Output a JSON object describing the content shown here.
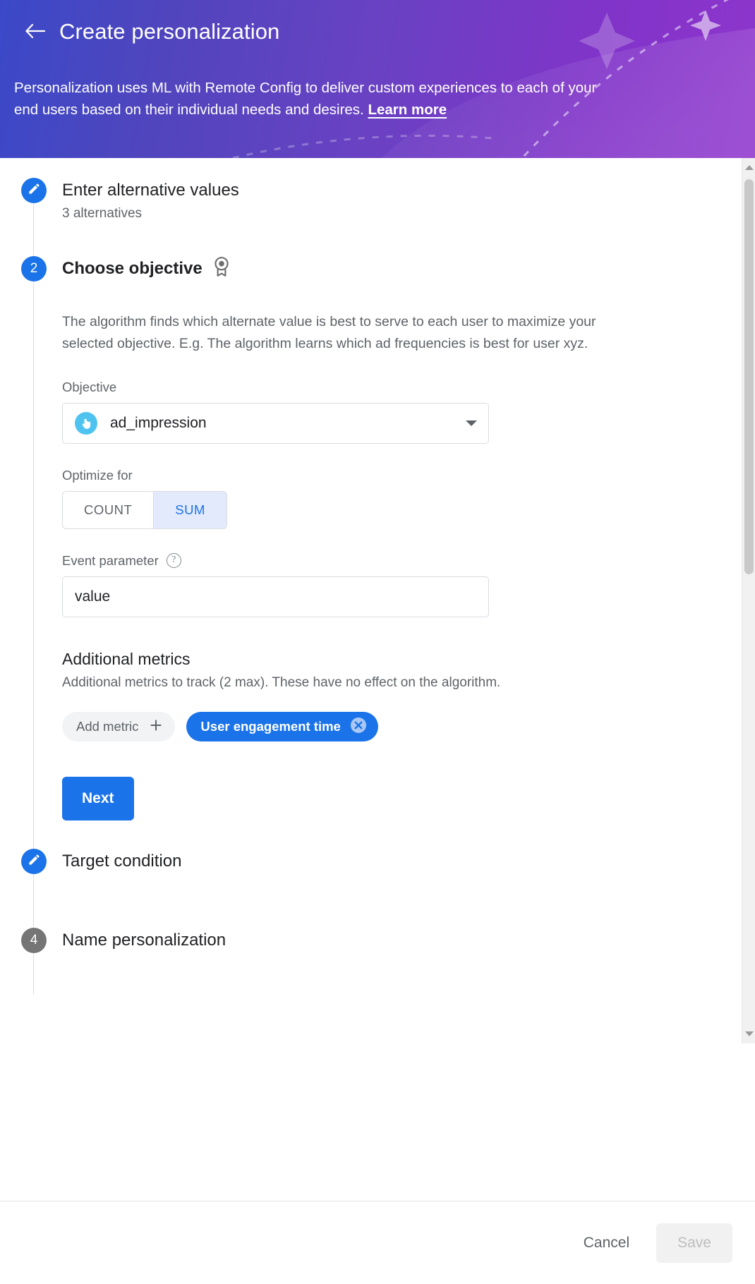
{
  "banner": {
    "back_icon": "arrow-left-icon",
    "title": "Create personalization",
    "description": "Personalization uses ML with Remote Config to deliver custom experiences to each of your end users based on their individual needs and desires. ",
    "learn_more": "Learn more",
    "gradient_start": "#3b49c8",
    "gradient_end": "#8e35cc"
  },
  "steps": [
    {
      "marker": "edit-icon",
      "marker_state": "complete",
      "title": "Enter alternative values",
      "subtitle": "3 alternatives"
    },
    {
      "marker": "2",
      "marker_state": "active",
      "title": "Choose objective",
      "title_icon": "medal-icon"
    },
    {
      "marker": "edit-icon",
      "marker_state": "complete",
      "title": "Target condition",
      "subtitle": ""
    },
    {
      "marker": "4",
      "marker_state": "pending",
      "title": "Name personalization",
      "subtitle": ""
    }
  ],
  "objective_panel": {
    "description": "The algorithm finds which alternate value is best to serve to each user to maximize your selected objective. E.g. The algorithm learns which ad frequencies is best for user xyz.",
    "objective_label": "Objective",
    "objective_value": "ad_impression",
    "objective_icon": "touch-tap-icon",
    "objective_icon_color": "#4ec3f0",
    "dropdown_icon": "chevron-down-icon",
    "optimize_label": "Optimize for",
    "optimize_options": [
      "COUNT",
      "SUM"
    ],
    "optimize_selected": "SUM",
    "event_param_label": "Event parameter",
    "event_param_help_icon": "help-circle-icon",
    "event_param_value": "value",
    "event_param_placeholder": "value",
    "additional_metrics_title": "Additional metrics",
    "additional_metrics_desc": "Additional metrics to track (2 max). These have no effect on the algorithm.",
    "add_metric_chip": "Add metric",
    "add_metric_icon": "plus-icon",
    "selected_metric_chip": "User engagement time",
    "remove_metric_icon": "close-circle-icon",
    "next_button": "Next",
    "accent_color": "#1a73e8"
  },
  "footer": {
    "cancel_label": "Cancel",
    "save_label": "Save",
    "save_disabled": true
  },
  "scrollbar": {
    "up_icon": "scroll-up-arrow-icon",
    "down_icon": "scroll-down-arrow-icon"
  }
}
